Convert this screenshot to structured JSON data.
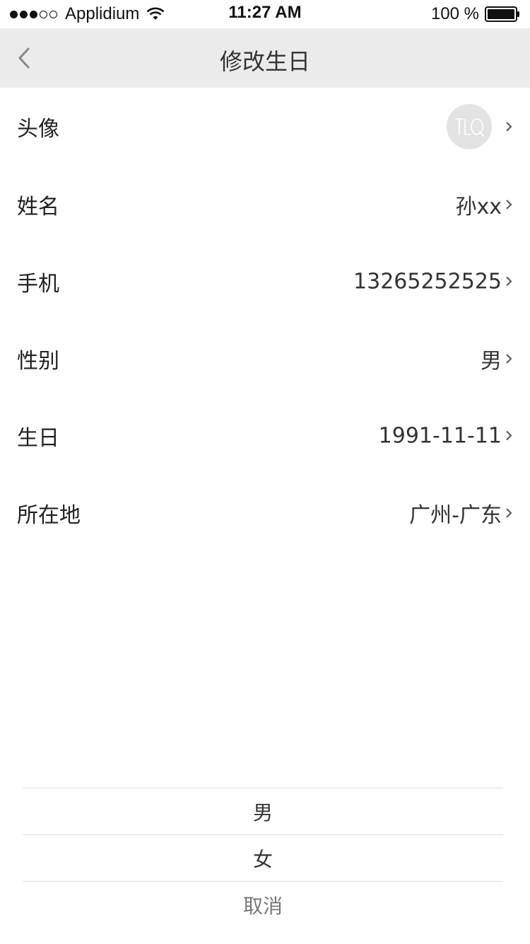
{
  "status_bar": {
    "carrier": "Applidium",
    "time": "11:27 AM",
    "battery": "100 %"
  },
  "nav": {
    "title": "修改生日",
    "back_icon": "chevron-left-icon"
  },
  "rows": [
    {
      "label": "头像",
      "value": "",
      "avatar_text": "TLQ"
    },
    {
      "label": "姓名",
      "value": "孙xx"
    },
    {
      "label": "手机",
      "value": "13265252525"
    },
    {
      "label": "性别",
      "value": "男"
    },
    {
      "label": "生日",
      "value": "1991-11-11"
    },
    {
      "label": "所在地",
      "value": "广州-广东"
    }
  ],
  "action_sheet": {
    "options": [
      "男",
      "女"
    ],
    "cancel": "取消"
  },
  "colors": {
    "nav_background": "#ebebeb",
    "text": "#222222",
    "divider": "#e0e0e0",
    "avatar_background": "#e3e3e3"
  }
}
